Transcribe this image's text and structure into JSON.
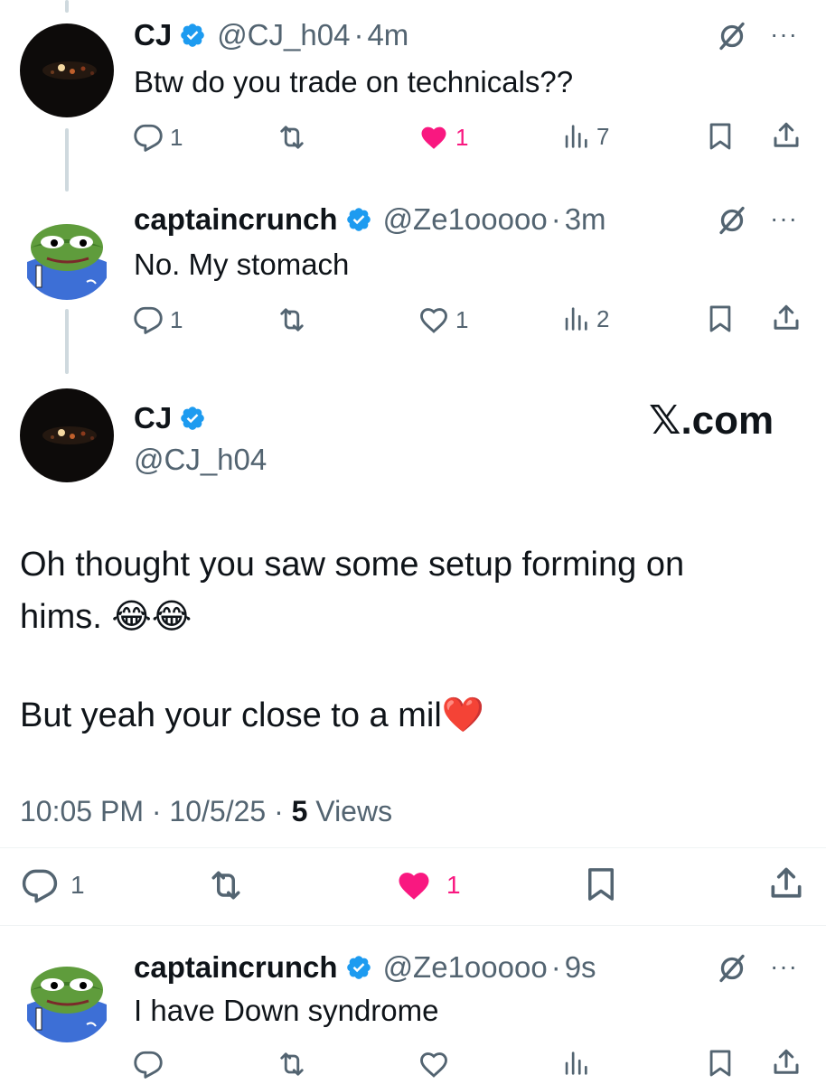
{
  "colors": {
    "accent": "#1d9bf0",
    "like": "#f91880",
    "secondary": "#536471",
    "thread_line": "#cfd9de"
  },
  "reply1": {
    "name": "CJ",
    "verified": true,
    "handle": "@CJ_h04",
    "sep": "·",
    "time": "4m",
    "text": "Btw do you trade on technicals??",
    "replies": "1",
    "reposts": "",
    "likes": "1",
    "liked": true,
    "views": "7"
  },
  "reply2": {
    "name": "captaincrunch",
    "verified": true,
    "handle": "@Ze1ooooo",
    "sep": "·",
    "time": "3m",
    "text": "No. My stomach",
    "replies": "1",
    "reposts": "",
    "likes": "1",
    "liked": false,
    "views": "2"
  },
  "focus": {
    "name": "CJ",
    "verified": true,
    "handle": "@CJ_h04",
    "watermark": "𝕏.com",
    "line1": "Oh thought you saw some setup forming on",
    "line2": "hims. 😂😂",
    "line3": "But yeah your close to a mil❤️",
    "timestamp": "10:05 PM · 10/5/25 · ",
    "views_count": "5",
    "views_label": " Views",
    "replies": "1",
    "likes": "1",
    "liked": true
  },
  "reply3": {
    "name": "captaincrunch",
    "verified": true,
    "handle": "@Ze1ooooo",
    "sep": "·",
    "time": "9s",
    "text": "I have Down syndrome",
    "replies": "",
    "reposts": "",
    "likes": "",
    "liked": false,
    "views": ""
  },
  "more_label": "···",
  "icons": [
    "reply-icon",
    "repost-icon",
    "like-icon",
    "views-icon",
    "bookmark-icon",
    "share-icon",
    "grok-icon",
    "more-icon",
    "verified-badge-icon"
  ]
}
